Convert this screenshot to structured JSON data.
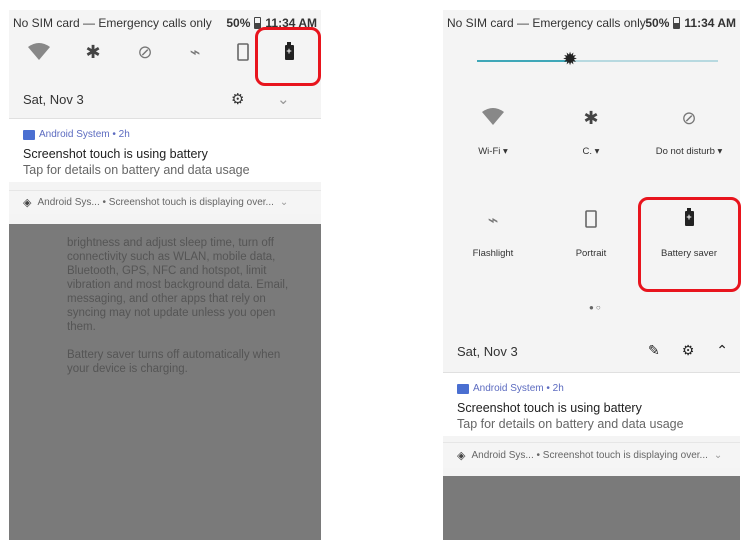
{
  "status_bar": {
    "carrier_text": "No SIM card — Emergency calls only",
    "battery_percent": "50%",
    "time": "11:34 AM"
  },
  "left_panel": {
    "quick_icons": [
      "wifi-icon",
      "bluetooth-icon",
      "do-not-disturb-icon",
      "flashlight-icon",
      "portrait-icon",
      "battery-saver-icon"
    ],
    "date": "Sat, Nov 3",
    "notification": {
      "app": "Android System • 2h",
      "title": "Screenshot touch is using battery",
      "text": "Tap for details on battery and data usage"
    },
    "sub_notification": "Android Sys... • Screenshot touch is displaying over...",
    "background_text": [
      "brightness and adjust sleep time, turn off connectivity such as WLAN, mobile data, Bluetooth, GPS, NFC and hotspot, limit vibration and most background data. Email, messaging, and other apps that rely on syncing may not update unless you open them.",
      "Battery saver turns off automatically when your device is charging."
    ]
  },
  "right_panel": {
    "tiles": [
      {
        "label": "Wi-Fi ▾",
        "icon": "wifi-icon"
      },
      {
        "label": "C. ▾",
        "icon": "bluetooth-icon"
      },
      {
        "label": "Do not disturb ▾",
        "icon": "do-not-disturb-icon"
      },
      {
        "label": "Flashlight",
        "icon": "flashlight-icon"
      },
      {
        "label": "Portrait",
        "icon": "portrait-icon"
      },
      {
        "label": "Battery saver",
        "icon": "battery-saver-icon"
      }
    ],
    "date": "Sat, Nov 3",
    "notification": {
      "app": "Android System • 2h",
      "title": "Screenshot touch is using battery",
      "text": "Tap for details on battery and data usage"
    },
    "sub_notification": "Android Sys... • Screenshot touch is displaying over..."
  },
  "colors": {
    "highlight": "#e8141d",
    "accent": "#3fa7b8"
  }
}
